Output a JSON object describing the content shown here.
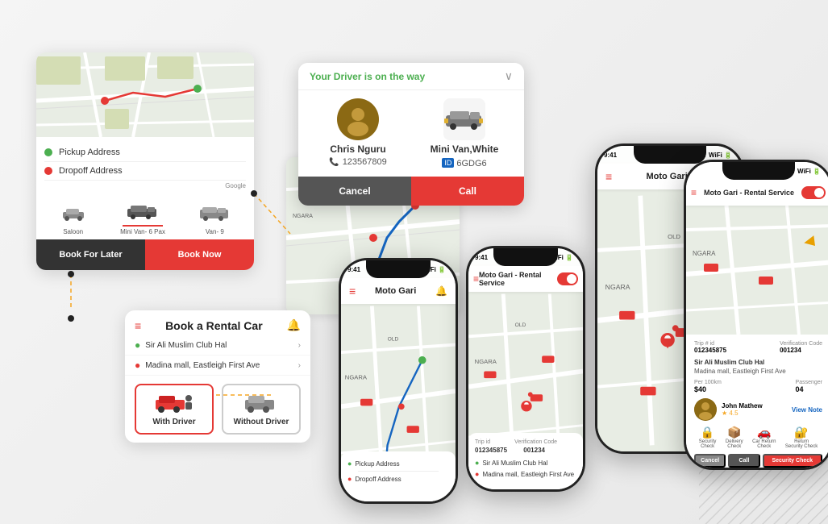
{
  "app": {
    "name": "Moto Gari"
  },
  "card_book_ride": {
    "pickup_placeholder": "Pickup Address",
    "dropoff_placeholder": "Dropoff Address",
    "google_label": "Google",
    "car_options": [
      {
        "id": "saloon",
        "label": "Saloon"
      },
      {
        "id": "mini_van_6",
        "label": "Mini Van- 6 Pax",
        "selected": true
      },
      {
        "id": "van_9",
        "label": "Van- 9"
      }
    ],
    "btn_later": "Book For Later",
    "btn_now": "Book Now"
  },
  "card_driver": {
    "status": "Your Driver is on the way",
    "driver_name": "Chris Nguru",
    "phone": "123567809",
    "car_type": "Mini Van,White",
    "plate": "6GDG6",
    "btn_cancel": "Cancel",
    "btn_call": "Call"
  },
  "card_rental": {
    "title": "Book a Rental Car",
    "location1": "Sir Ali Muslim Club Hal",
    "location2": "Madina mall, Eastleigh First Ave",
    "opt1": "With Driver",
    "opt2": "Without Driver"
  },
  "phone1": {
    "time": "9:41",
    "title": "Moto Gari",
    "pickup": "Pickup Address",
    "dropoff": "Dropoff Address"
  },
  "phone2": {
    "time": "9:41",
    "title": "Moto Gari - Rental Service",
    "location1": "Sir Ali Muslim Club Hal",
    "location2": "Madina mall, Eastleigh First Ave"
  },
  "phone3": {
    "time": "9:41",
    "title": "Moto Gari"
  },
  "phone4": {
    "time": "",
    "title": "Moto Gari - Rental Service",
    "trip_id": "012345875",
    "verification": "001234",
    "location1": "Sir Ali Muslim Club Hal",
    "location2": "Madina mall, Eastleigh First Ave",
    "per_km": "Per 100km",
    "km_cost": "$40",
    "passenger": "Passenger",
    "pass_count": "04",
    "driver": "John Mathew",
    "rating": "4.5",
    "btn_cancel": "Cancel",
    "btn_call": "Call",
    "btn_security": "Security Check"
  },
  "icons": {
    "hamburger": "≡",
    "bell": "🔔",
    "chevron_right": "›",
    "pin_green": "📍",
    "pin_red": "📍",
    "phone_icon": "📞",
    "car_icon": "🚗",
    "person_icon": "👤"
  }
}
